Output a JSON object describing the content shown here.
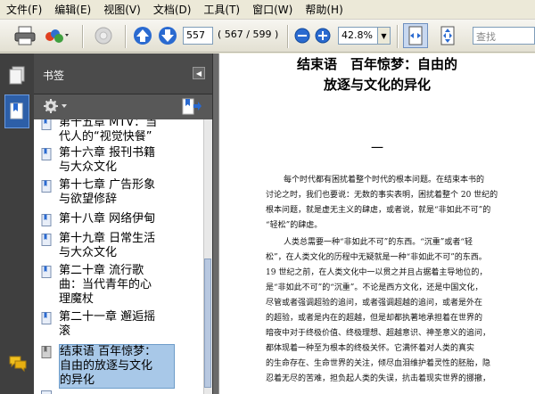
{
  "menu": [
    "文件(F)",
    "编辑(E)",
    "视图(V)",
    "文档(D)",
    "工具(T)",
    "窗口(W)",
    "帮助(H)"
  ],
  "toolbar": {
    "page_current": "557",
    "page_count": "( 567 / 599 )",
    "zoom": "42.8%",
    "search_placeholder": "查找"
  },
  "panel": {
    "title": "书签"
  },
  "bookmarks": [
    {
      "text": "第十五章 MTV：当代人的“视觉快餐”",
      "lines": [
        "第十五章 MTV：当",
        "代人的“视觉快餐”"
      ],
      "selected": false
    },
    {
      "text": "第十六章 报刊书籍与大众文化",
      "lines": [
        "第十六章 报刊书籍",
        "与大众文化"
      ],
      "selected": false
    },
    {
      "text": "第十七章 广告形象与欲望修辞",
      "lines": [
        "第十七章 广告形象",
        "与欲望修辞"
      ],
      "selected": false
    },
    {
      "text": "第十八章 网络伊甸",
      "lines": [
        "第十八章 网络伊甸"
      ],
      "selected": false
    },
    {
      "text": "第十九章 日常生活与大众文化",
      "lines": [
        "第十九章 日常生活",
        "与大众文化"
      ],
      "selected": false
    },
    {
      "text": "第二十章 流行歌曲：当代青年的心理魔杖",
      "lines": [
        "第二十章 流行歌",
        "曲：当代青年的心",
        "理魔杖"
      ],
      "selected": false
    },
    {
      "text": "第二十一章 邂逅摇滚",
      "lines": [
        "第二十一章 邂逅摇",
        "滚"
      ],
      "selected": false
    },
    {
      "text": "结束语 百年惊梦：自由的放逐与文化的异化",
      "lines": [
        "结束语 百年惊梦：",
        "自由的放逐与文化",
        "的异化"
      ],
      "selected": true
    }
  ],
  "document": {
    "title_line1": "结束语　百年惊梦：自由的",
    "title_line2": "放逐与文化的异化",
    "section": "一",
    "paragraph1": [
      "每个时代都有困扰着整个时代的根本问题。在结束本书的",
      "讨论之时，我们也要说：无数的事实表明，困扰着整个 20 世纪的",
      "根本问题，就是虚无主义的肆虐，或者说，就是“非如此不可”的",
      "“轻松”的肆虐。"
    ],
    "paragraph2": [
      "人类总需要一种“非如此不可”的东西。“沉重”或者“轻",
      "松”，在人类文化的历程中无疑就是一种“非如此不可”的东西。",
      "19 世纪之前，在人类文化中一以贯之并且占据着主导地位的，",
      "是“非如此不可”的“沉重”。不论是西方文化，还是中国文化，",
      "尽管或者强调超验的追问，或者强调超越的追问，或者是外在",
      "的超验，或者是内在的超越，但是却都执著地承担着在世界的",
      "暗夜中对于终极价值、终极理想、超越意识、神圣意义的追问，",
      "都体现着一种至为根本的终极关怀。它满怀着对人类的真实",
      "的生命存在、生命世界的关注，倾尽血泪维护着灵性的胚胎，隐",
      "忍着无尽的苦难，担负起人类的失误，抗击着现实世界的挪撤，"
    ]
  },
  "colors": {
    "accent_blue": "#1f5fbf",
    "selected_bg": "#a8c8e8",
    "panel_bg": "#5a5a5a"
  }
}
